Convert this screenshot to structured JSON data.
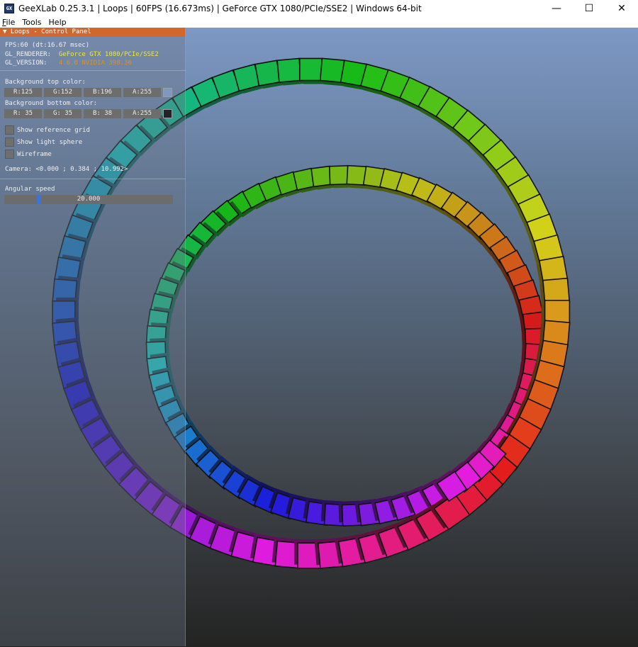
{
  "window": {
    "app_icon_text": "GX",
    "title": "GeeXLab 0.25.3.1 | Loops | 60FPS (16.673ms) | GeForce GTX 1080/PCIe/SSE2 | Windows 64-bit",
    "minimize_glyph": "—",
    "maximize_glyph": "☐",
    "close_glyph": "✕"
  },
  "menu": {
    "file": {
      "accel": "F",
      "rest": "ile"
    },
    "tools": "Tools",
    "help": "Help"
  },
  "panel": {
    "header": "▼ Loops - Control Panel",
    "fps": "FPS:60 (dt:16.67 msec)",
    "renderer_label": "GL_RENDERER:",
    "renderer_value": "GeForce GTX 1080/PCIe/SSE2",
    "version_label": "GL_VERSION:",
    "version_value": "4.6.0 NVIDIA 398.36",
    "bg_top_label": "Background top color:",
    "bg_top": {
      "r": "R:125",
      "g": "G:152",
      "b": "B:196",
      "a": "A:255",
      "swatch": "#7d98c4"
    },
    "bg_bottom_label": "Background bottom color:",
    "bg_bottom": {
      "r": "R: 35",
      "g": "G: 35",
      "b": "B: 38",
      "a": "A:255",
      "swatch": "#232326"
    },
    "show_grid": "Show reference grid",
    "show_light": "Show light sphere",
    "wireframe": "Wireframe",
    "camera": "Camera: <0.000 ; 0.384 ; 10.992>",
    "angular_speed_label": "Angular speed",
    "angular_speed_value": "20.000",
    "angular_speed_fraction": 0.2
  },
  "scene": {
    "loops": [
      {
        "cubes": 72,
        "hue_start": 130,
        "hue_span": 360
      },
      {
        "cubes": 68,
        "hue_start": 90,
        "hue_span": 360
      }
    ]
  }
}
